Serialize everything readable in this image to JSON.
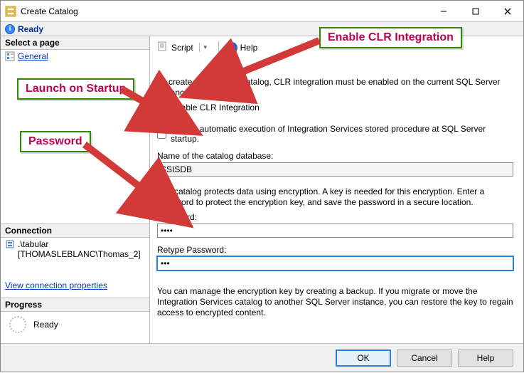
{
  "window": {
    "title": "Create Catalog"
  },
  "status": {
    "text": "Ready"
  },
  "sidebar": {
    "selectPage": {
      "header": "Select a page",
      "general": "General"
    },
    "connection": {
      "header": "Connection",
      "server": ".\\tabular",
      "user": "[THOMASLEBLANC\\Thomas_2]"
    },
    "link": "View connection properties",
    "progress": {
      "header": "Progress",
      "text": "Ready"
    }
  },
  "toolbar": {
    "script": "Script",
    "help": "Help"
  },
  "main": {
    "intro": "To create and use the catalog, CLR integration must be enabled on the current SQL Server instance.",
    "chk_clr": "Enable CLR Integration",
    "chk_auto": "Enable automatic execution of Integration Services stored procedure at SQL Server startup.",
    "db_label": "Name of the catalog database:",
    "db_value": "SSISDB",
    "enc_text": "The catalog protects data using encryption. A key is needed for this encryption. Enter a password to protect the encryption key, and save the password in a secure location.",
    "pwd_label": "Password:",
    "pwd_value": "••••",
    "pwd2_label": "Retype Password:",
    "pwd2_value": "•••",
    "backup_text": "You can manage the encryption key by creating a backup. If you migrate or move the Integration Services catalog to another SQL Server instance, you can restore the key to regain access to encrypted content."
  },
  "buttons": {
    "ok": "OK",
    "cancel": "Cancel",
    "help": "Help"
  },
  "callouts": {
    "clr": "Enable CLR Integration",
    "launch": "Launch on Startup",
    "password": "Password"
  }
}
